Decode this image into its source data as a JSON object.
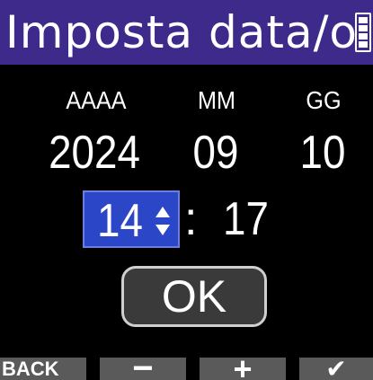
{
  "header": {
    "title": "Imposta data/o",
    "battery_icon": "battery-icon"
  },
  "date": {
    "year_label": "AAAA",
    "month_label": "MM",
    "day_label": "GG",
    "year": "2024",
    "month": "09",
    "day": "10"
  },
  "time": {
    "hour": "14",
    "separator": ":",
    "minute": "17",
    "selected_field": "hour",
    "selector_icon": "up-down-arrows-icon"
  },
  "ok_label": "OK",
  "footer": {
    "back_label": "BACK",
    "minus_label": "−",
    "plus_label": "+",
    "enter_label": "✔"
  },
  "colors": {
    "title_bar": "#3d2a8a",
    "selection": "#2c46c8",
    "footer_key": "#5a5a5a",
    "background": "#000000"
  }
}
